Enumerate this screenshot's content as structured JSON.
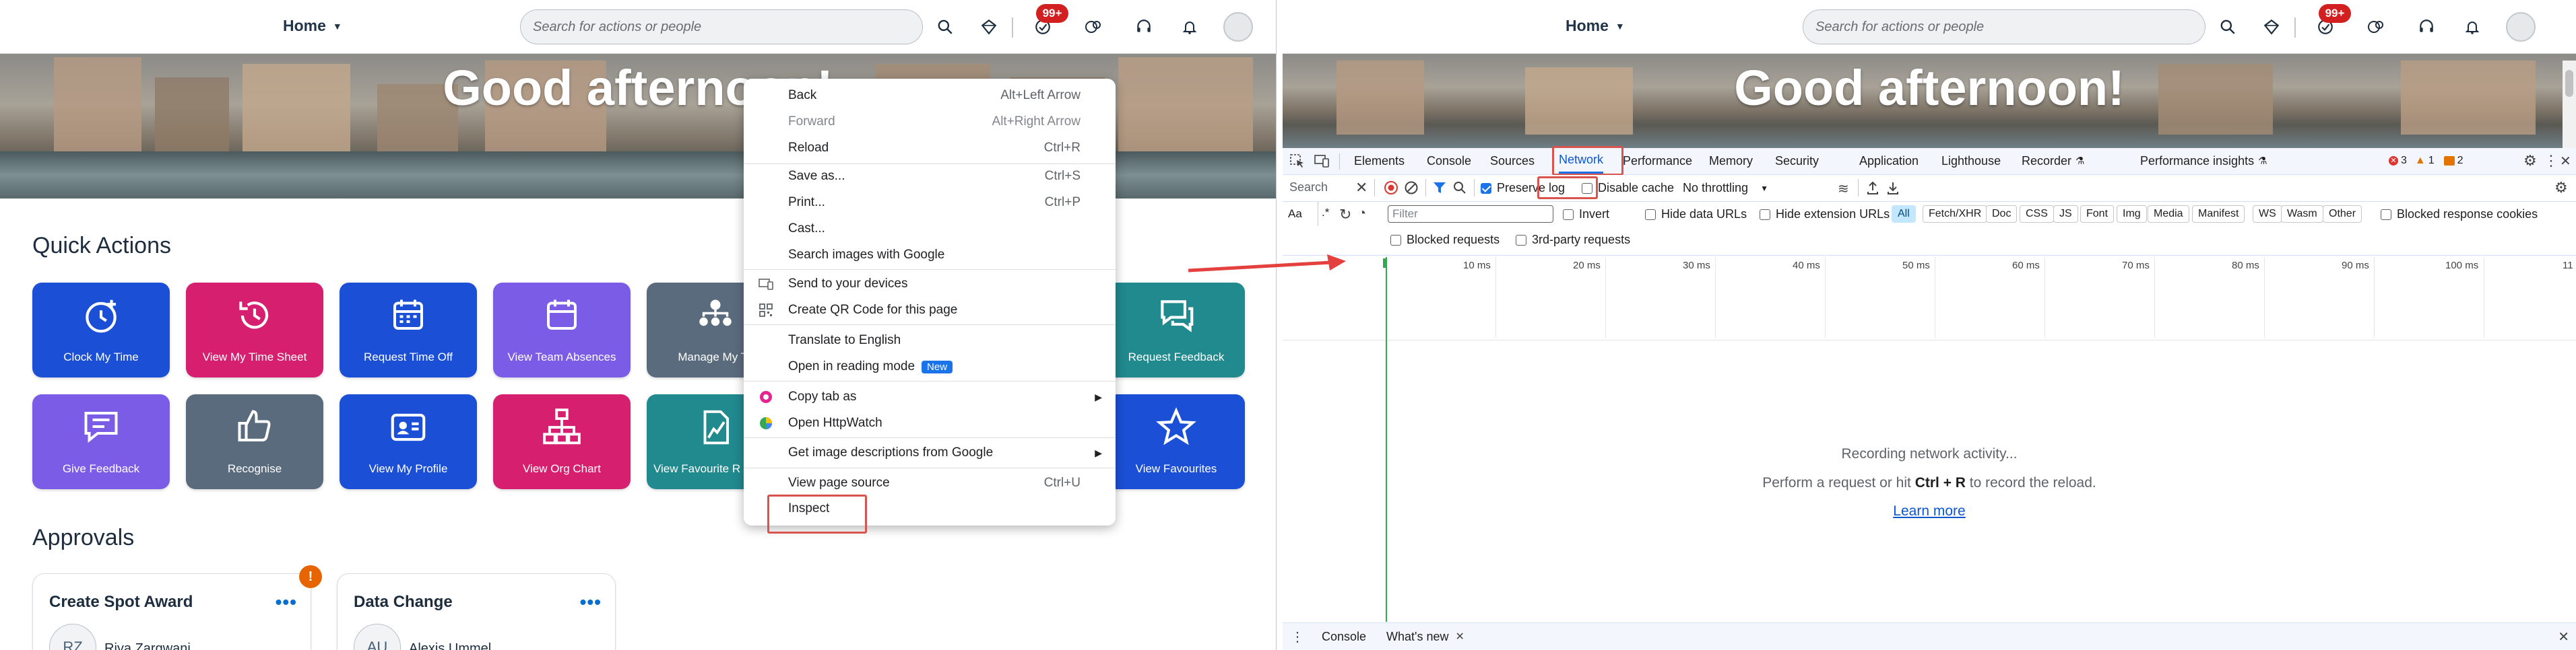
{
  "shell": {
    "home_label": "Home",
    "search_placeholder": "Search for actions or people",
    "notif_badge": "99+"
  },
  "hero": {
    "greeting": "Good afternoon!"
  },
  "quick_actions": {
    "title": "Quick Actions",
    "tiles": [
      {
        "label": "Clock My Time",
        "icon": "clock-plus-icon",
        "color": "#1b4fd6"
      },
      {
        "label": "View My Time Sheet",
        "icon": "history-icon",
        "color": "#d6206f"
      },
      {
        "label": "Request Time Off",
        "icon": "calendar-icon",
        "color": "#1b4fd6"
      },
      {
        "label": "View Team Absences",
        "icon": "calendar-icon",
        "color": "#7b5ce6"
      },
      {
        "label": "Manage My Te",
        "icon": "org-people-icon",
        "color": "#5b6b7e"
      },
      {
        "label": "Request Feedback",
        "icon": "feedback-icon",
        "color": "#218a8f"
      },
      {
        "label": "Give Feedback",
        "icon": "comment-icon",
        "color": "#7b5ce6"
      },
      {
        "label": "Recognise",
        "icon": "thumbs-up-icon",
        "color": "#5b6b7e"
      },
      {
        "label": "View My Profile",
        "icon": "id-card-icon",
        "color": "#1b4fd6"
      },
      {
        "label": "View Org Chart",
        "icon": "org-chart-icon",
        "color": "#d6206f"
      },
      {
        "label": "View Favourite R",
        "icon": "report-icon",
        "color": "#218a8f"
      },
      {
        "label": "View Favourites",
        "icon": "star-icon",
        "color": "#1b4fd6"
      }
    ]
  },
  "approvals": {
    "title": "Approvals",
    "cards": [
      {
        "title": "Create Spot Award",
        "initials": "RZ",
        "person": "Riya Zargwani",
        "warning": "!"
      },
      {
        "title": "Data Change",
        "initials": "AU",
        "person": "Alexis Ummel"
      }
    ]
  },
  "context_menu": {
    "items": [
      {
        "label": "Back",
        "shortcut": "Alt+Left Arrow"
      },
      {
        "label": "Forward",
        "shortcut": "Alt+Right Arrow",
        "disabled": true
      },
      {
        "label": "Reload",
        "shortcut": "Ctrl+R"
      },
      {
        "label": "Save as...",
        "shortcut": "Ctrl+S"
      },
      {
        "label": "Print...",
        "shortcut": "Ctrl+P"
      },
      {
        "label": "Cast..."
      },
      {
        "label": "Search images with Google"
      },
      {
        "label": "Send to your devices",
        "icon": "devices-icon"
      },
      {
        "label": "Create QR Code for this page",
        "icon": "qr-code-icon"
      },
      {
        "label": "Translate to English"
      },
      {
        "label": "Open in reading mode",
        "badge": "New"
      },
      {
        "label": "Copy tab as",
        "icon": "copy-tab-icon",
        "submenu": true
      },
      {
        "label": "Open HttpWatch",
        "icon": "httpwatch-icon"
      },
      {
        "label": "Get image descriptions from Google",
        "submenu": true
      },
      {
        "label": "View page source",
        "shortcut": "Ctrl+U"
      },
      {
        "label": "Inspect"
      }
    ]
  },
  "devtools": {
    "tabs": [
      "Elements",
      "Console",
      "Sources",
      "Network",
      "Performance",
      "Memory",
      "Security",
      "Application",
      "Lighthouse",
      "Recorder",
      "Performance insights"
    ],
    "active_tab": "Network",
    "errors": "3",
    "warnings": "1",
    "issues": "2",
    "search_label": "Search",
    "preserve_log": "Preserve log",
    "disable_cache": "Disable cache",
    "throttling": "No throttling",
    "aa": "Aa",
    "regex": ".*",
    "filter_placeholder": "Filter",
    "invert": "Invert",
    "hide_data_urls": "Hide data URLs",
    "hide_ext_urls": "Hide extension URLs",
    "type_filters": [
      "All",
      "Fetch/XHR",
      "Doc",
      "CSS",
      "JS",
      "Font",
      "Img",
      "Media",
      "Manifest",
      "WS",
      "Wasm",
      "Other"
    ],
    "blocked_response_cookies": "Blocked response cookies",
    "blocked_requests": "Blocked requests",
    "third_party": "3rd-party requests",
    "timeline_ticks": [
      "10 ms",
      "20 ms",
      "30 ms",
      "40 ms",
      "50 ms",
      "60 ms",
      "70 ms",
      "80 ms",
      "90 ms",
      "100 ms",
      "11"
    ],
    "recording": "Recording network activity...",
    "hint_pre": "Perform a request or hit ",
    "hint_keys": "Ctrl + R",
    "hint_post": " to record the reload.",
    "learn_more": "Learn more",
    "drawer_console": "Console",
    "drawer_whats_new": "What's new"
  }
}
